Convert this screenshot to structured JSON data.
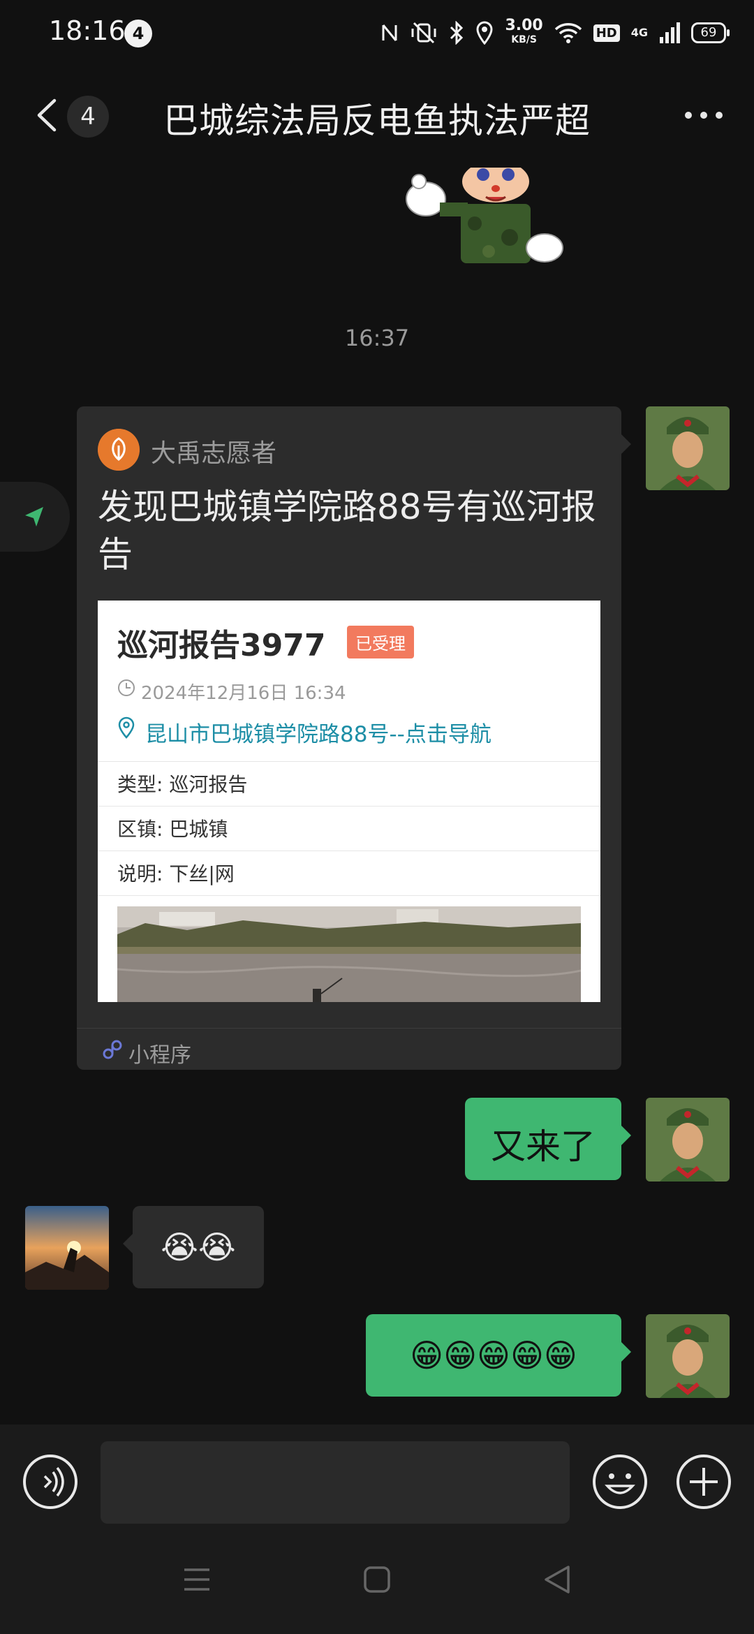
{
  "status_bar": {
    "time": "18:16",
    "notification_count": "4",
    "speed_value": "3.00",
    "speed_unit": "KB/S",
    "hd": "HD",
    "network": "4G",
    "battery": "69"
  },
  "header": {
    "unread_count": "4",
    "title": "巴城综法局反电鱼执法严超"
  },
  "messages": {
    "timestamp": "16:37",
    "mini_program": {
      "source": "大禹志愿者",
      "title": "发现巴城镇学院路88号有巡河报告",
      "report_title": "巡河报告3977",
      "status_badge": "已受理",
      "date": "2024年12月16日 16:34",
      "location": "昆山市巴城镇学院路88号--点击导航",
      "fields": [
        {
          "label": "类型: ",
          "value": "巡河报告"
        },
        {
          "label": "区镇: ",
          "value": "巴城镇"
        },
        {
          "label": "说明: ",
          "value": "下丝|网"
        }
      ],
      "footer": "小程序"
    },
    "msg_sent_1": "又来了",
    "msg_received_emoji": "😭😭",
    "msg_sent_emoji": "😁😁😁😁😁"
  },
  "input_bar": {
    "placeholder": ""
  },
  "colors": {
    "background": "#111111",
    "bubble_sent": "#3fb771",
    "bubble_received": "#2c2c2c",
    "link": "#1d8ea6",
    "badge": "#f27a5e"
  },
  "icons": [
    "back-icon",
    "more-icon",
    "voice-icon",
    "emoji-icon",
    "plus-icon",
    "location-icon",
    "clock-icon",
    "mini-program-icon",
    "share-arrow-icon"
  ]
}
